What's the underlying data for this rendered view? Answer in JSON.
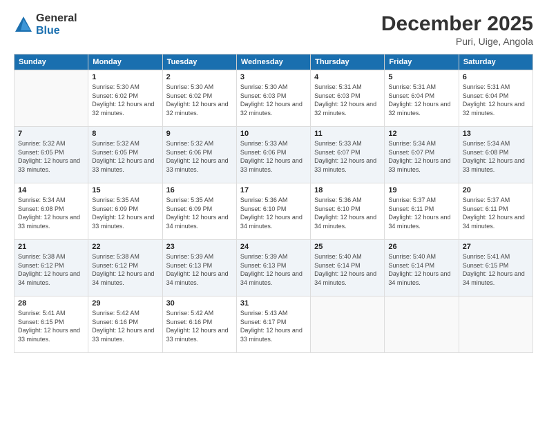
{
  "logo": {
    "general": "General",
    "blue": "Blue"
  },
  "title": {
    "month": "December 2025",
    "location": "Puri, Uige, Angola"
  },
  "header_days": [
    "Sunday",
    "Monday",
    "Tuesday",
    "Wednesday",
    "Thursday",
    "Friday",
    "Saturday"
  ],
  "weeks": [
    [
      {
        "num": "",
        "sunrise": "",
        "sunset": "",
        "daylight": ""
      },
      {
        "num": "1",
        "sunrise": "Sunrise: 5:30 AM",
        "sunset": "Sunset: 6:02 PM",
        "daylight": "Daylight: 12 hours and 32 minutes."
      },
      {
        "num": "2",
        "sunrise": "Sunrise: 5:30 AM",
        "sunset": "Sunset: 6:02 PM",
        "daylight": "Daylight: 12 hours and 32 minutes."
      },
      {
        "num": "3",
        "sunrise": "Sunrise: 5:30 AM",
        "sunset": "Sunset: 6:03 PM",
        "daylight": "Daylight: 12 hours and 32 minutes."
      },
      {
        "num": "4",
        "sunrise": "Sunrise: 5:31 AM",
        "sunset": "Sunset: 6:03 PM",
        "daylight": "Daylight: 12 hours and 32 minutes."
      },
      {
        "num": "5",
        "sunrise": "Sunrise: 5:31 AM",
        "sunset": "Sunset: 6:04 PM",
        "daylight": "Daylight: 12 hours and 32 minutes."
      },
      {
        "num": "6",
        "sunrise": "Sunrise: 5:31 AM",
        "sunset": "Sunset: 6:04 PM",
        "daylight": "Daylight: 12 hours and 32 minutes."
      }
    ],
    [
      {
        "num": "7",
        "sunrise": "Sunrise: 5:32 AM",
        "sunset": "Sunset: 6:05 PM",
        "daylight": "Daylight: 12 hours and 33 minutes."
      },
      {
        "num": "8",
        "sunrise": "Sunrise: 5:32 AM",
        "sunset": "Sunset: 6:05 PM",
        "daylight": "Daylight: 12 hours and 33 minutes."
      },
      {
        "num": "9",
        "sunrise": "Sunrise: 5:32 AM",
        "sunset": "Sunset: 6:06 PM",
        "daylight": "Daylight: 12 hours and 33 minutes."
      },
      {
        "num": "10",
        "sunrise": "Sunrise: 5:33 AM",
        "sunset": "Sunset: 6:06 PM",
        "daylight": "Daylight: 12 hours and 33 minutes."
      },
      {
        "num": "11",
        "sunrise": "Sunrise: 5:33 AM",
        "sunset": "Sunset: 6:07 PM",
        "daylight": "Daylight: 12 hours and 33 minutes."
      },
      {
        "num": "12",
        "sunrise": "Sunrise: 5:34 AM",
        "sunset": "Sunset: 6:07 PM",
        "daylight": "Daylight: 12 hours and 33 minutes."
      },
      {
        "num": "13",
        "sunrise": "Sunrise: 5:34 AM",
        "sunset": "Sunset: 6:08 PM",
        "daylight": "Daylight: 12 hours and 33 minutes."
      }
    ],
    [
      {
        "num": "14",
        "sunrise": "Sunrise: 5:34 AM",
        "sunset": "Sunset: 6:08 PM",
        "daylight": "Daylight: 12 hours and 33 minutes."
      },
      {
        "num": "15",
        "sunrise": "Sunrise: 5:35 AM",
        "sunset": "Sunset: 6:09 PM",
        "daylight": "Daylight: 12 hours and 33 minutes."
      },
      {
        "num": "16",
        "sunrise": "Sunrise: 5:35 AM",
        "sunset": "Sunset: 6:09 PM",
        "daylight": "Daylight: 12 hours and 34 minutes."
      },
      {
        "num": "17",
        "sunrise": "Sunrise: 5:36 AM",
        "sunset": "Sunset: 6:10 PM",
        "daylight": "Daylight: 12 hours and 34 minutes."
      },
      {
        "num": "18",
        "sunrise": "Sunrise: 5:36 AM",
        "sunset": "Sunset: 6:10 PM",
        "daylight": "Daylight: 12 hours and 34 minutes."
      },
      {
        "num": "19",
        "sunrise": "Sunrise: 5:37 AM",
        "sunset": "Sunset: 6:11 PM",
        "daylight": "Daylight: 12 hours and 34 minutes."
      },
      {
        "num": "20",
        "sunrise": "Sunrise: 5:37 AM",
        "sunset": "Sunset: 6:11 PM",
        "daylight": "Daylight: 12 hours and 34 minutes."
      }
    ],
    [
      {
        "num": "21",
        "sunrise": "Sunrise: 5:38 AM",
        "sunset": "Sunset: 6:12 PM",
        "daylight": "Daylight: 12 hours and 34 minutes."
      },
      {
        "num": "22",
        "sunrise": "Sunrise: 5:38 AM",
        "sunset": "Sunset: 6:12 PM",
        "daylight": "Daylight: 12 hours and 34 minutes."
      },
      {
        "num": "23",
        "sunrise": "Sunrise: 5:39 AM",
        "sunset": "Sunset: 6:13 PM",
        "daylight": "Daylight: 12 hours and 34 minutes."
      },
      {
        "num": "24",
        "sunrise": "Sunrise: 5:39 AM",
        "sunset": "Sunset: 6:13 PM",
        "daylight": "Daylight: 12 hours and 34 minutes."
      },
      {
        "num": "25",
        "sunrise": "Sunrise: 5:40 AM",
        "sunset": "Sunset: 6:14 PM",
        "daylight": "Daylight: 12 hours and 34 minutes."
      },
      {
        "num": "26",
        "sunrise": "Sunrise: 5:40 AM",
        "sunset": "Sunset: 6:14 PM",
        "daylight": "Daylight: 12 hours and 34 minutes."
      },
      {
        "num": "27",
        "sunrise": "Sunrise: 5:41 AM",
        "sunset": "Sunset: 6:15 PM",
        "daylight": "Daylight: 12 hours and 34 minutes."
      }
    ],
    [
      {
        "num": "28",
        "sunrise": "Sunrise: 5:41 AM",
        "sunset": "Sunset: 6:15 PM",
        "daylight": "Daylight: 12 hours and 33 minutes."
      },
      {
        "num": "29",
        "sunrise": "Sunrise: 5:42 AM",
        "sunset": "Sunset: 6:16 PM",
        "daylight": "Daylight: 12 hours and 33 minutes."
      },
      {
        "num": "30",
        "sunrise": "Sunrise: 5:42 AM",
        "sunset": "Sunset: 6:16 PM",
        "daylight": "Daylight: 12 hours and 33 minutes."
      },
      {
        "num": "31",
        "sunrise": "Sunrise: 5:43 AM",
        "sunset": "Sunset: 6:17 PM",
        "daylight": "Daylight: 12 hours and 33 minutes."
      },
      {
        "num": "",
        "sunrise": "",
        "sunset": "",
        "daylight": ""
      },
      {
        "num": "",
        "sunrise": "",
        "sunset": "",
        "daylight": ""
      },
      {
        "num": "",
        "sunrise": "",
        "sunset": "",
        "daylight": ""
      }
    ]
  ]
}
